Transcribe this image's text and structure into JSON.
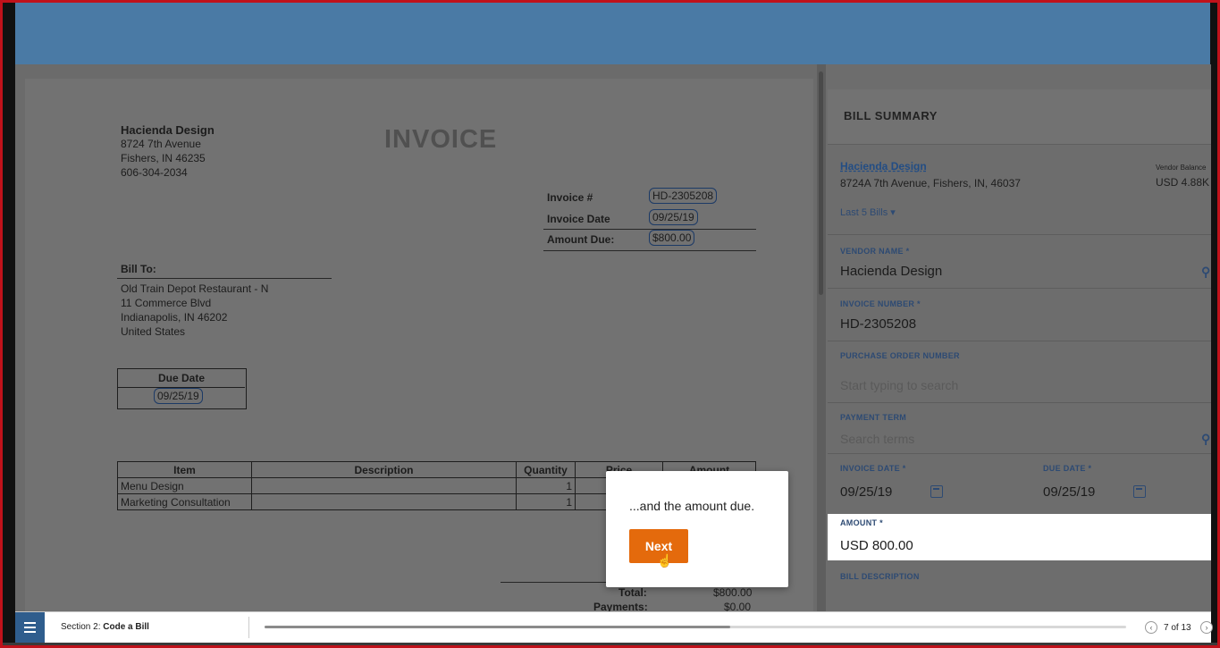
{
  "invoice_doc": {
    "vendor": {
      "name": "Hacienda Design",
      "address1": "8724 7th Avenue",
      "address2": "Fishers, IN 46235",
      "phone": "606-304-2034"
    },
    "title": "INVOICE",
    "fields": [
      {
        "label": "Invoice #",
        "value": "HD-2305208"
      },
      {
        "label": "Invoice Date",
        "value": "09/25/19"
      },
      {
        "label": "Amount Due:",
        "value": "$800.00"
      }
    ],
    "bill_to": {
      "heading": "Bill To:",
      "lines": [
        "Old Train Depot Restaurant - N",
        "11 Commerce Blvd",
        "Indianapolis, IN 46202",
        "United States"
      ]
    },
    "due_date": {
      "label": "Due Date",
      "value": "09/25/19"
    },
    "table": {
      "headers": [
        "Item",
        "Description",
        "Quantity",
        "Price",
        "Amount"
      ],
      "rows": [
        {
          "item": "Menu Design",
          "description": "",
          "quantity": "1"
        },
        {
          "item": "Marketing Consultation",
          "description": "",
          "quantity": "1"
        }
      ]
    },
    "totals": [
      {
        "label": "Total:",
        "value": "$800.00"
      },
      {
        "label": "Payments:",
        "value": "$0.00"
      }
    ]
  },
  "bill_summary": {
    "heading": "BILL SUMMARY",
    "vendor_link": "Hacienda Design",
    "vendor_address": "8724A 7th Avenue, Fishers, IN, 46037",
    "vendor_balance_label": "Vendor Balance",
    "vendor_balance_value": "USD 4.88K",
    "last_bills": "Last 5 Bills",
    "vendor_name_label": "VENDOR NAME *",
    "vendor_name_value": "Hacienda Design",
    "invoice_number_label": "INVOICE NUMBER *",
    "invoice_number_value": "HD-2305208",
    "po_label": "PURCHASE ORDER NUMBER",
    "po_placeholder": "Start typing to search",
    "payment_term_label": "PAYMENT TERM",
    "payment_term_placeholder": "Search terms",
    "invoice_date_label": "INVOICE DATE *",
    "invoice_date_value": "09/25/19",
    "due_date_label": "DUE DATE *",
    "due_date_value": "09/25/19",
    "amount_label": "AMOUNT *",
    "amount_value": "USD 800.00",
    "bill_description_label": "BILL DESCRIPTION"
  },
  "popup": {
    "text": "...and the amount due.",
    "button": "Next"
  },
  "bottom_bar": {
    "section_prefix": "Section 2:",
    "section_name": "Code a Bill",
    "page": "7 of 13",
    "progress": 0.54
  },
  "colors": {
    "header_blue": "#4a7aa5",
    "accent_orange": "#e46a0c",
    "frame_red": "#c0121b",
    "menu_blue": "#2f5d8d"
  }
}
